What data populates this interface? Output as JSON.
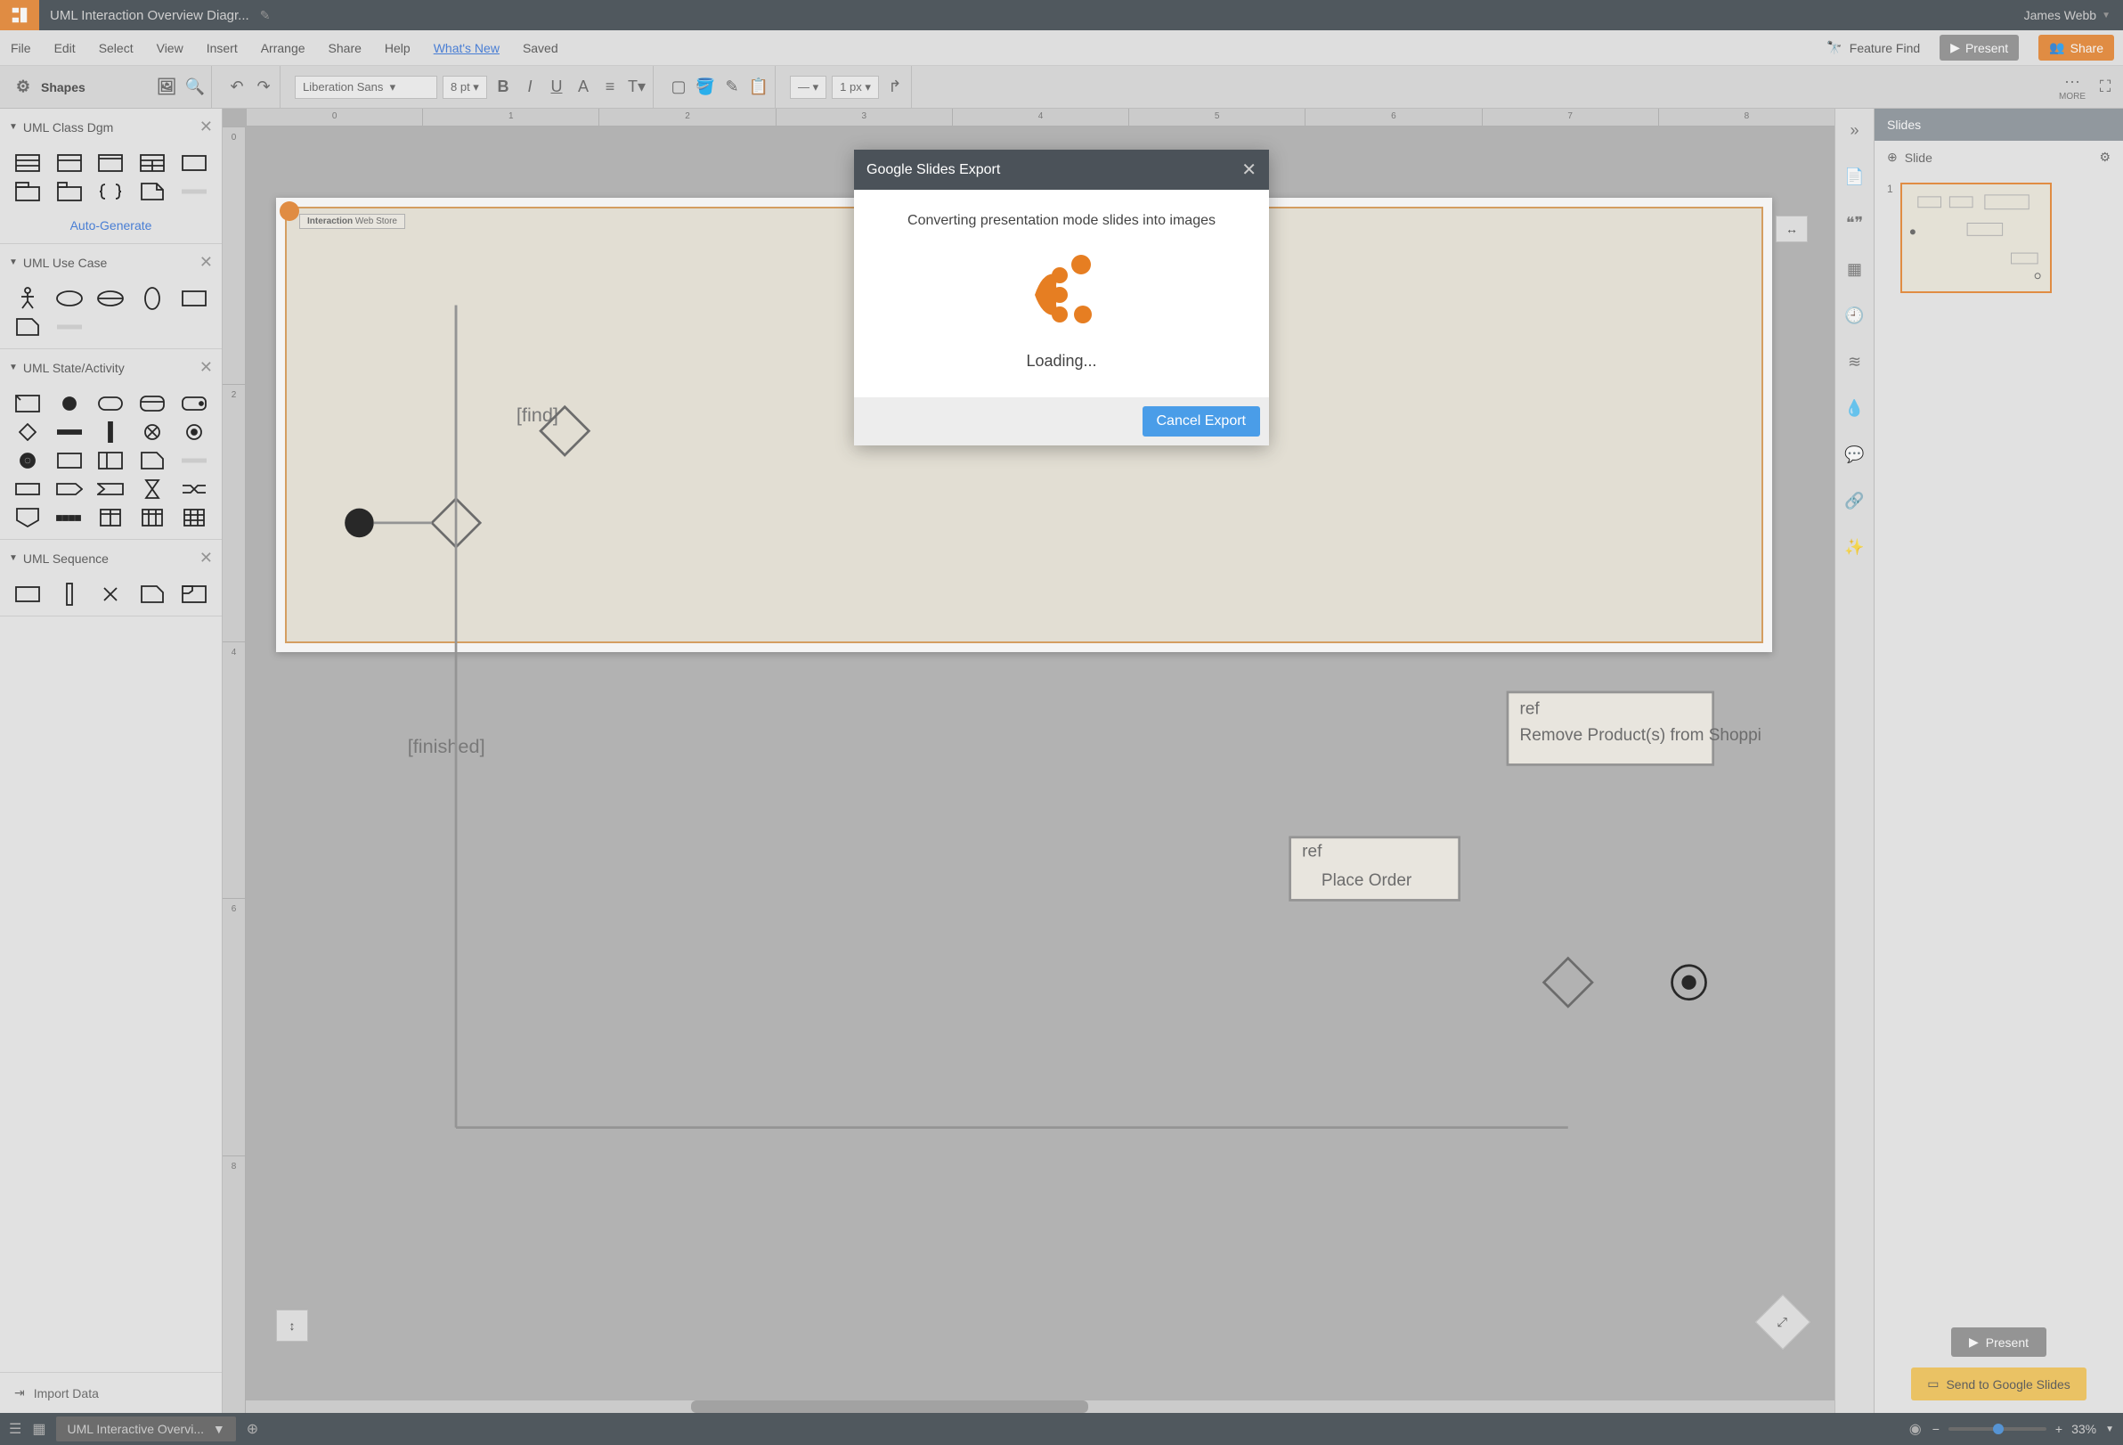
{
  "titlebar": {
    "doc_title": "UML Interaction Overview Diagr...",
    "user_name": "James Webb"
  },
  "menubar": {
    "items": [
      "File",
      "Edit",
      "Select",
      "View",
      "Insert",
      "Arrange",
      "Share",
      "Help"
    ],
    "whats_new": "What's New",
    "saved": "Saved",
    "feature_find": "Feature Find",
    "present": "Present",
    "share": "Share"
  },
  "toolbar": {
    "shapes_label": "Shapes",
    "font": "Liberation Sans",
    "font_size": "8 pt",
    "line_width": "1 px",
    "more": "MORE"
  },
  "left_panel": {
    "sections": [
      {
        "title": "UML Class Dgm",
        "auto_generate": "Auto-Generate"
      },
      {
        "title": "UML Use Case"
      },
      {
        "title": "UML State/Activity"
      },
      {
        "title": "UML Sequence"
      }
    ],
    "import_data": "Import Data"
  },
  "canvas": {
    "ruler_marks_h": [
      "0",
      "1",
      "2",
      "3",
      "4",
      "5",
      "6",
      "7",
      "8"
    ],
    "ruler_marks_v": [
      "0",
      "2",
      "4",
      "6",
      "8"
    ],
    "slide_title_prefix": "Interaction",
    "slide_title_name": "Web Store",
    "annotations": {
      "find": "[find]",
      "finished": "[finished]",
      "ref1": "ref",
      "remove_product": "Remove Product(s) from Shopping Cart",
      "place_order_ref": "ref",
      "place_order": "Place Order"
    }
  },
  "right_panel": {
    "header": "Slides",
    "slide_label": "Slide",
    "thumb_num": "1",
    "present": "Present",
    "send_gslides": "Send to Google Slides"
  },
  "bottombar": {
    "tab_name": "UML Interactive Overvi...",
    "zoom": "33%"
  },
  "modal": {
    "title": "Google Slides Export",
    "message": "Converting presentation mode slides into images",
    "loading": "Loading...",
    "cancel": "Cancel Export"
  }
}
